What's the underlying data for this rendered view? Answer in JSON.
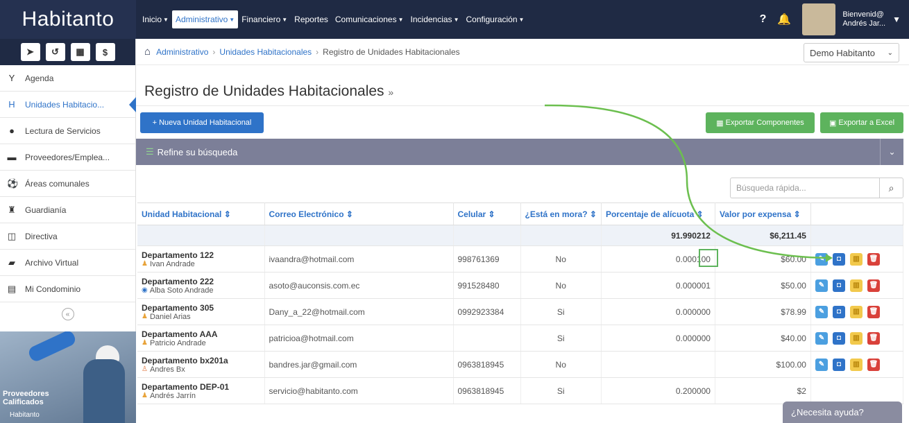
{
  "brand": "Habitanto",
  "nav": [
    {
      "label": "Inicio",
      "active": false
    },
    {
      "label": "Administrativo",
      "active": true
    },
    {
      "label": "Financiero",
      "active": false
    },
    {
      "label": "Reportes",
      "active": false
    },
    {
      "label": "Comunicaciones",
      "active": false
    },
    {
      "label": "Incidencias",
      "active": false
    },
    {
      "label": "Configuración",
      "active": false
    }
  ],
  "user": {
    "greeting": "Bienvenid@",
    "name": "Andrés Jar..."
  },
  "sidebar": {
    "quick_buttons": [
      "send-icon",
      "history-icon",
      "calculator-icon",
      "dollar-icon"
    ],
    "items": [
      {
        "label": "Agenda",
        "icon": "tie-icon"
      },
      {
        "label": "Unidades Habitacio...",
        "icon": "h-icon",
        "active": true
      },
      {
        "label": "Lectura de Servicios",
        "icon": "drop-icon"
      },
      {
        "label": "Proveedores/Emplea...",
        "icon": "truck-icon"
      },
      {
        "label": "Áreas comunales",
        "icon": "ball-icon"
      },
      {
        "label": "Guardianía",
        "icon": "guard-icon"
      },
      {
        "label": "Directiva",
        "icon": "columns-icon"
      },
      {
        "label": "Archivo Virtual",
        "icon": "book-icon"
      },
      {
        "label": "Mi Condominio",
        "icon": "building-icon"
      }
    ],
    "promo_text_1": "Proveedores",
    "promo_text_2": "Calificados",
    "promo_logo": "Habitanto"
  },
  "breadcrumb": {
    "items": [
      "Administrativo",
      "Unidades Habitacionales"
    ],
    "current": "Registro de Unidades Habitacionales"
  },
  "condo_select": "Demo Habitanto",
  "page_title": "Registro de Unidades Habitacionales",
  "title_chevron": "»",
  "buttons": {
    "new_unit": "Nueva Unidad Habitacional",
    "export_components": "Exportar Componentes",
    "export_excel": "Exportar a Excel"
  },
  "refine_label": "Refine su búsqueda",
  "search_placeholder": "Búsqueda rápida...",
  "table": {
    "headers": [
      "Unidad Habitacional",
      "Correo Electrónico",
      "Celular",
      "¿Está en mora?",
      "Porcentaje de alícuota",
      "Valor por expensa"
    ],
    "totals": {
      "alicuota": "91.990212",
      "expensa": "$6,211.45"
    },
    "rows": [
      {
        "unit": "Departamento 122",
        "owner": "Ivan Andrade",
        "owner_type": "person",
        "email": "ivaandra@hotmail.com",
        "phone": "998761369",
        "mora": "No",
        "alicuota": "0.000100",
        "expensa": "$60.00"
      },
      {
        "unit": "Departamento 222",
        "owner": "Alba Soto Andrade",
        "owner_type": "user",
        "email": "asoto@auconsis.com.ec",
        "phone": "991528480",
        "mora": "No",
        "alicuota": "0.000001",
        "expensa": "$50.00"
      },
      {
        "unit": "Departamento 305",
        "owner": "Daniel Arias",
        "owner_type": "person",
        "email": "Dany_a_22@hotmail.com",
        "phone": "0992923384",
        "mora": "Si",
        "alicuota": "0.000000",
        "expensa": "$78.99"
      },
      {
        "unit": "Departamento AAA",
        "owner": "Patricio Andrade",
        "owner_type": "person",
        "email": "patricioa@hotmail.com",
        "phone": "",
        "mora": "Si",
        "alicuota": "0.000000",
        "expensa": "$40.00"
      },
      {
        "unit": "Departamento bx201a",
        "owner": "Andres Bx",
        "owner_type": "outline",
        "email": "bandres.jar@gmail.com",
        "phone": "0963818945",
        "mora": "No",
        "alicuota": "",
        "expensa": "$100.00"
      },
      {
        "unit": "Departamento DEP-01",
        "owner": "Andrés Jarrín",
        "owner_type": "person",
        "email": "servicio@habitanto.com",
        "phone": "0963818945",
        "mora": "Si",
        "alicuota": "0.200000",
        "expensa": "$2"
      }
    ]
  },
  "help_label": "¿Necesita ayuda?"
}
